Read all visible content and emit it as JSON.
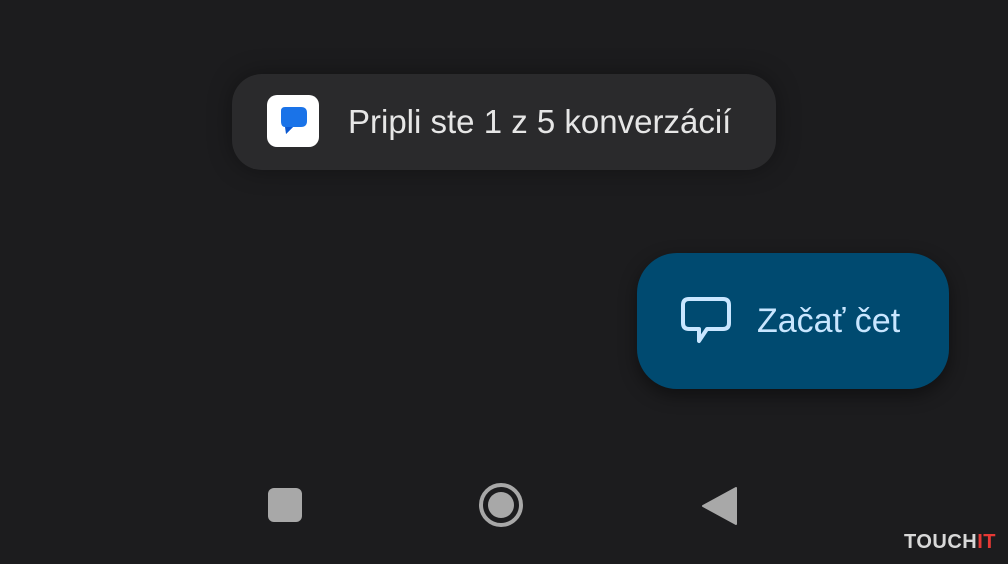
{
  "toast": {
    "text": "Pripli ste 1 z 5 konverzácií",
    "app_icon": "messages-icon"
  },
  "fab": {
    "label": "Začať čet",
    "icon": "chat-bubble-outline-icon"
  },
  "navbar": {
    "recents_icon": "square-icon",
    "home_icon": "circle-home-icon",
    "back_icon": "triangle-back-icon"
  },
  "watermark": {
    "text_main": "TOUCH",
    "text_accent": "IT"
  },
  "colors": {
    "background": "#1c1c1e",
    "toast_bg": "#2a2a2c",
    "fab_bg": "#004a70",
    "fab_text": "#c9e6ff",
    "messages_blue": "#1a73e8",
    "nav_gray": "#a8a8a8",
    "watermark_accent": "#e53935"
  }
}
